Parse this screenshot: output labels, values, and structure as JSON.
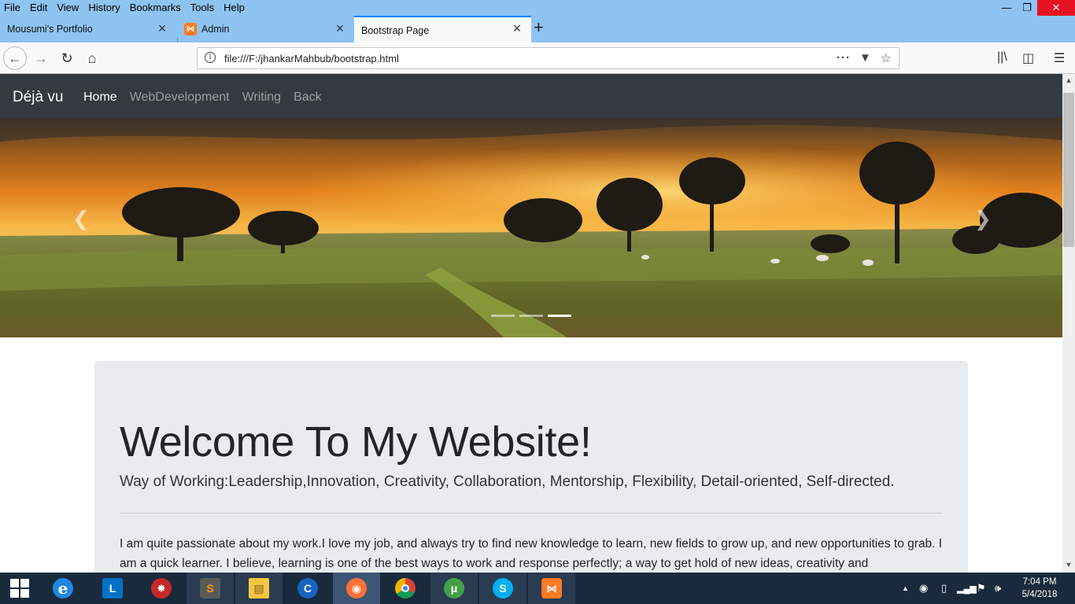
{
  "browser": {
    "menu": [
      "File",
      "Edit",
      "View",
      "History",
      "Bookmarks",
      "Tools",
      "Help"
    ],
    "tabs": [
      {
        "title": "Mousumi's Portfolio",
        "active": false
      },
      {
        "title": "Admin",
        "active": false
      },
      {
        "title": "Bootstrap Page",
        "active": true
      }
    ],
    "url": "file:///F:/jhankarMahbub/bootstrap.html"
  },
  "site": {
    "brand": "Déjà vu",
    "nav": [
      "Home",
      "WebDevelopment",
      "Writing",
      "Back"
    ],
    "carousel": {
      "slide_count": 3,
      "active_slide": 3
    },
    "jumbotron": {
      "title": "Welcome To My Website!",
      "lead": "Way of Working:Leadership,Innovation, Creativity, Collaboration, Mentorship, Flexibility, Detail-oriented, Self-directed.",
      "body": "I am quite passionate about my work.I love my job, and always try to find new knowledge to learn, new fields to grow up, and new opportunities to grab. I am a quick learner. I believe, learning is one of the best ways to work and response perfectly; a way to get hold of new ideas, creativity and"
    }
  },
  "taskbar": {
    "apps": [
      "start-icon",
      "internet-explorer-icon",
      "lync-icon",
      "security-app-icon",
      "sublime-text-icon",
      "file-explorer-icon",
      "ccleaner-icon",
      "firefox-icon",
      "chrome-icon",
      "utorrent-icon",
      "skype-icon",
      "xampp-icon"
    ],
    "time": "7:04 PM",
    "date": "5/4/2018"
  },
  "colors": {
    "titlebar": "#8ec3f2",
    "site_navbar": "#343a40",
    "jumbotron": "#e9ecef",
    "taskbar": "#1a2a3d"
  }
}
